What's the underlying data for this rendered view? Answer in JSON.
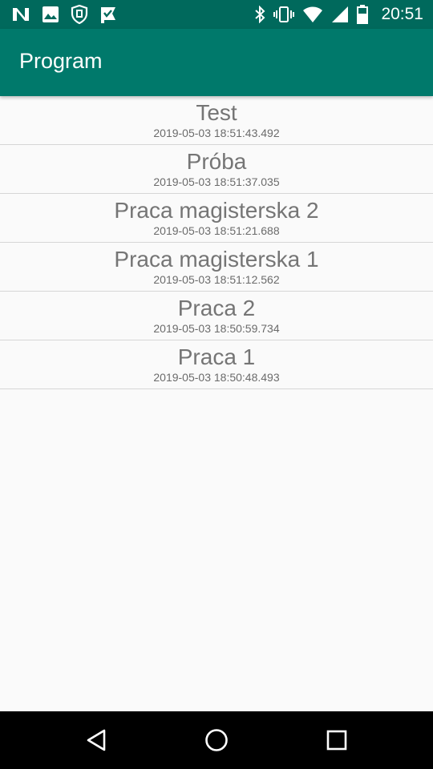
{
  "status_bar": {
    "time": "20:51",
    "left_icons": [
      "n-logo-icon",
      "image-icon",
      "shield-icon",
      "check-flag-icon"
    ],
    "right_icons": [
      "bluetooth-icon",
      "vibrate-icon",
      "wifi-icon",
      "signal-icon",
      "battery-icon"
    ]
  },
  "app_bar": {
    "title": "Program",
    "color": "#00796b",
    "status_color": "#00695c"
  },
  "list": {
    "items": [
      {
        "title": "Test",
        "timestamp": "2019-05-03 18:51:43.492"
      },
      {
        "title": "Próba",
        "timestamp": "2019-05-03 18:51:37.035"
      },
      {
        "title": "Praca magisterska 2",
        "timestamp": "2019-05-03 18:51:21.688"
      },
      {
        "title": "Praca magisterska 1",
        "timestamp": "2019-05-03 18:51:12.562"
      },
      {
        "title": "Praca 2",
        "timestamp": "2019-05-03 18:50:59.734"
      },
      {
        "title": "Praca 1",
        "timestamp": "2019-05-03 18:50:48.493"
      }
    ]
  },
  "nav_bar": {
    "buttons": [
      "back-icon",
      "home-icon",
      "recents-icon"
    ]
  }
}
